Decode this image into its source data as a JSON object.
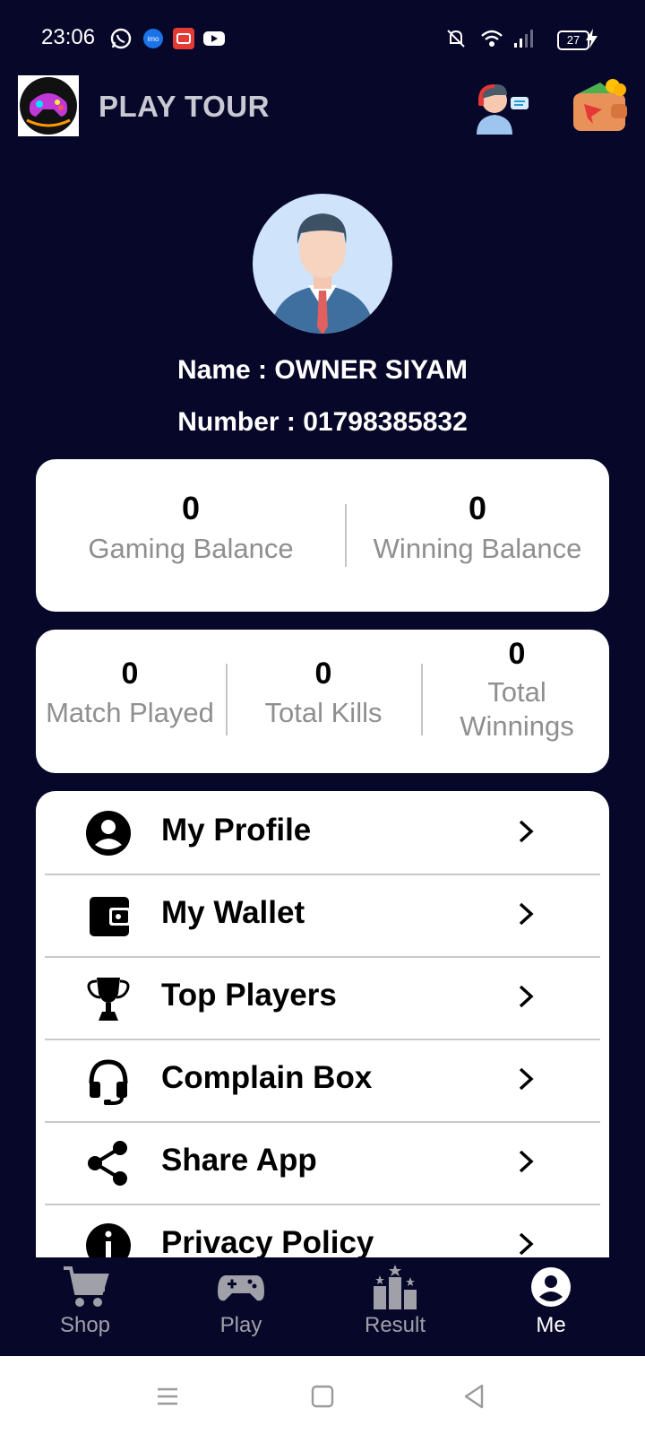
{
  "status_bar": {
    "time": "23:06",
    "battery": "27",
    "icons": [
      "whatsapp-icon",
      "imo-icon",
      "screen-record-icon",
      "youtube-icon",
      "mute-icon",
      "wifi-icon",
      "signal-icon",
      "battery-icon",
      "charging-icon"
    ]
  },
  "header": {
    "title": "PLAY TOUR",
    "icons": [
      "app-logo",
      "support-icon",
      "wallet-icon"
    ]
  },
  "profile": {
    "name": "Name : OWNER SIYAM",
    "number": "Number : 01798385832"
  },
  "balances": [
    {
      "value": "0",
      "label": "Gaming Balance"
    },
    {
      "value": "0",
      "label": "Winning Balance"
    }
  ],
  "stats": [
    {
      "value": "0",
      "label": "Match Played"
    },
    {
      "value": "0",
      "label": "Total Kills"
    },
    {
      "value": "0",
      "label": "Total Winnings"
    }
  ],
  "menu": {
    "items": [
      {
        "label": "My Profile",
        "icon": "account-circle-icon"
      },
      {
        "label": "My Wallet",
        "icon": "wallet-icon"
      },
      {
        "label": "Top Players",
        "icon": "trophy-icon"
      },
      {
        "label": "Complain Box",
        "icon": "headset-icon"
      },
      {
        "label": "Share App",
        "icon": "share-icon"
      },
      {
        "label": "Privacy Policy",
        "icon": "info-icon"
      }
    ]
  },
  "bottom_nav": {
    "items": [
      {
        "label": "Shop",
        "icon": "cart-icon"
      },
      {
        "label": "Play",
        "icon": "gamepad-icon"
      },
      {
        "label": "Result",
        "icon": "podium-icon"
      },
      {
        "label": "Me",
        "icon": "person-icon"
      }
    ],
    "active": "Me"
  },
  "colors": {
    "background": "#07072a",
    "card": "#ffffff",
    "muted_text": "#8f8f8f",
    "nav_inactive": "#9fa0a8"
  }
}
